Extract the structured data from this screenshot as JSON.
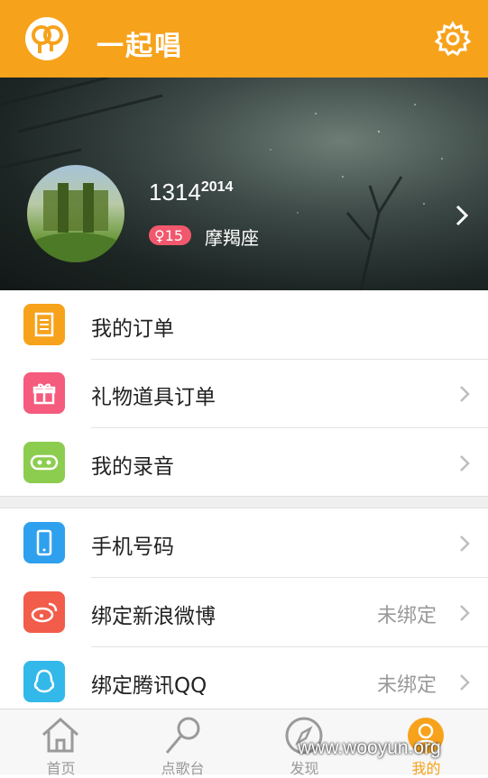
{
  "header": {
    "app_title": "一起唱",
    "logo_icon": "microphone-logo-icon",
    "settings_icon": "gear-icon",
    "bg_color": "#f7a21b"
  },
  "profile": {
    "username": "1314",
    "username_sup": "2014",
    "gender_badge": "♀15",
    "zodiac": "摩羯座"
  },
  "menu_section1": [
    {
      "label": "我的订单",
      "icon": "receipt-icon",
      "color": "#f7a21b",
      "value": ""
    },
    {
      "label": "礼物道具订单",
      "icon": "gift-icon",
      "color": "#f45b7d",
      "value": ""
    },
    {
      "label": "我的录音",
      "icon": "cassette-icon",
      "color": "#8ccc4f",
      "value": ""
    }
  ],
  "menu_section2": [
    {
      "label": "手机号码",
      "icon": "phone-icon",
      "color": "#2fa0ee",
      "value": ""
    },
    {
      "label": "绑定新浪微博",
      "icon": "weibo-icon",
      "color": "#f25c4a",
      "value": "未绑定"
    },
    {
      "label": "绑定腾讯QQ",
      "icon": "qq-icon",
      "color": "#33b8ea",
      "value": "未绑定"
    }
  ],
  "tabbar": [
    {
      "label": "首页",
      "icon": "home-icon",
      "active": false
    },
    {
      "label": "点歌台",
      "icon": "microphone-icon",
      "active": false
    },
    {
      "label": "发现",
      "icon": "compass-icon",
      "active": false
    },
    {
      "label": "我的",
      "icon": "user-icon",
      "active": true
    }
  ],
  "watermark": "www.wooyun.org"
}
